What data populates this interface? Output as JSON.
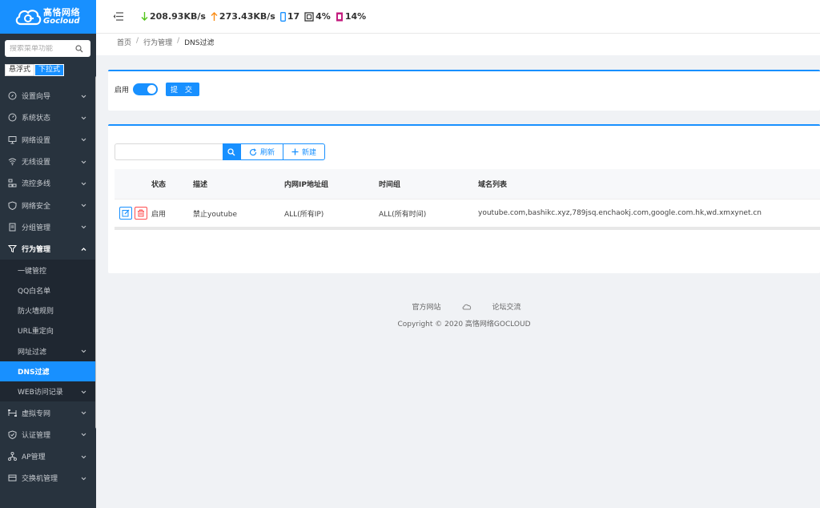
{
  "brand": {
    "name_cn": "高恪网络",
    "name_en": "Gocloud",
    "color": "#1890ff"
  },
  "sidebar": {
    "search_placeholder": "搜索菜单功能",
    "mode_tabs": [
      "悬浮式",
      "下拉式"
    ],
    "items": [
      {
        "label": "设置向导",
        "icon": "compass-icon"
      },
      {
        "label": "系统状态",
        "icon": "gauge-icon"
      },
      {
        "label": "网络设置",
        "icon": "monitor-icon"
      },
      {
        "label": "无线设置",
        "icon": "wifi-icon"
      },
      {
        "label": "流控多线",
        "icon": "network-icon"
      },
      {
        "label": "网络安全",
        "icon": "shield-icon"
      },
      {
        "label": "分组管理",
        "icon": "document-icon"
      },
      {
        "label": "行为管理",
        "icon": "filter-icon"
      }
    ],
    "submenu": [
      {
        "label": "一键管控"
      },
      {
        "label": "QQ白名单"
      },
      {
        "label": "防火墙规则"
      },
      {
        "label": "URL重定向"
      },
      {
        "label": "网址过滤"
      },
      {
        "label": "DNS过滤"
      },
      {
        "label": "WEB访问记录"
      }
    ],
    "items_after": [
      {
        "label": "虚拟专网",
        "icon": "vpn-icon"
      },
      {
        "label": "认证管理",
        "icon": "shield-check-icon"
      },
      {
        "label": "AP管理",
        "icon": "ap-icon"
      },
      {
        "label": "交换机管理",
        "icon": "switch-icon"
      }
    ]
  },
  "header": {
    "download": "208.93KB/s",
    "upload": "273.43KB/s",
    "devices": "17",
    "cpu": "4%",
    "memory": "14%"
  },
  "breadcrumb": [
    "首页",
    "行为管理",
    "DNS过滤"
  ],
  "settings": {
    "enable_label": "启用",
    "enabled": true,
    "submit_label": "提 交"
  },
  "toolbar": {
    "search_value": "",
    "refresh_label": "刷新",
    "new_label": "新建"
  },
  "table": {
    "columns": [
      "",
      "状态",
      "描述",
      "内网IP地址组",
      "时间组",
      "域名列表"
    ],
    "rows": [
      {
        "status": "启用",
        "desc": "禁止youtube",
        "ip_group": "ALL(所有IP)",
        "time_group": "ALL(所有时间)",
        "domains": "youtube.com,bashikc.xyz,789jsq.enchaokj.com,google.com.hk,wd.xmxynet.cn"
      }
    ]
  },
  "footer": {
    "link1": "官方网站",
    "link2": "论坛交流",
    "copyright": "Copyright © 2020 高恪网络GOCLOUD"
  }
}
